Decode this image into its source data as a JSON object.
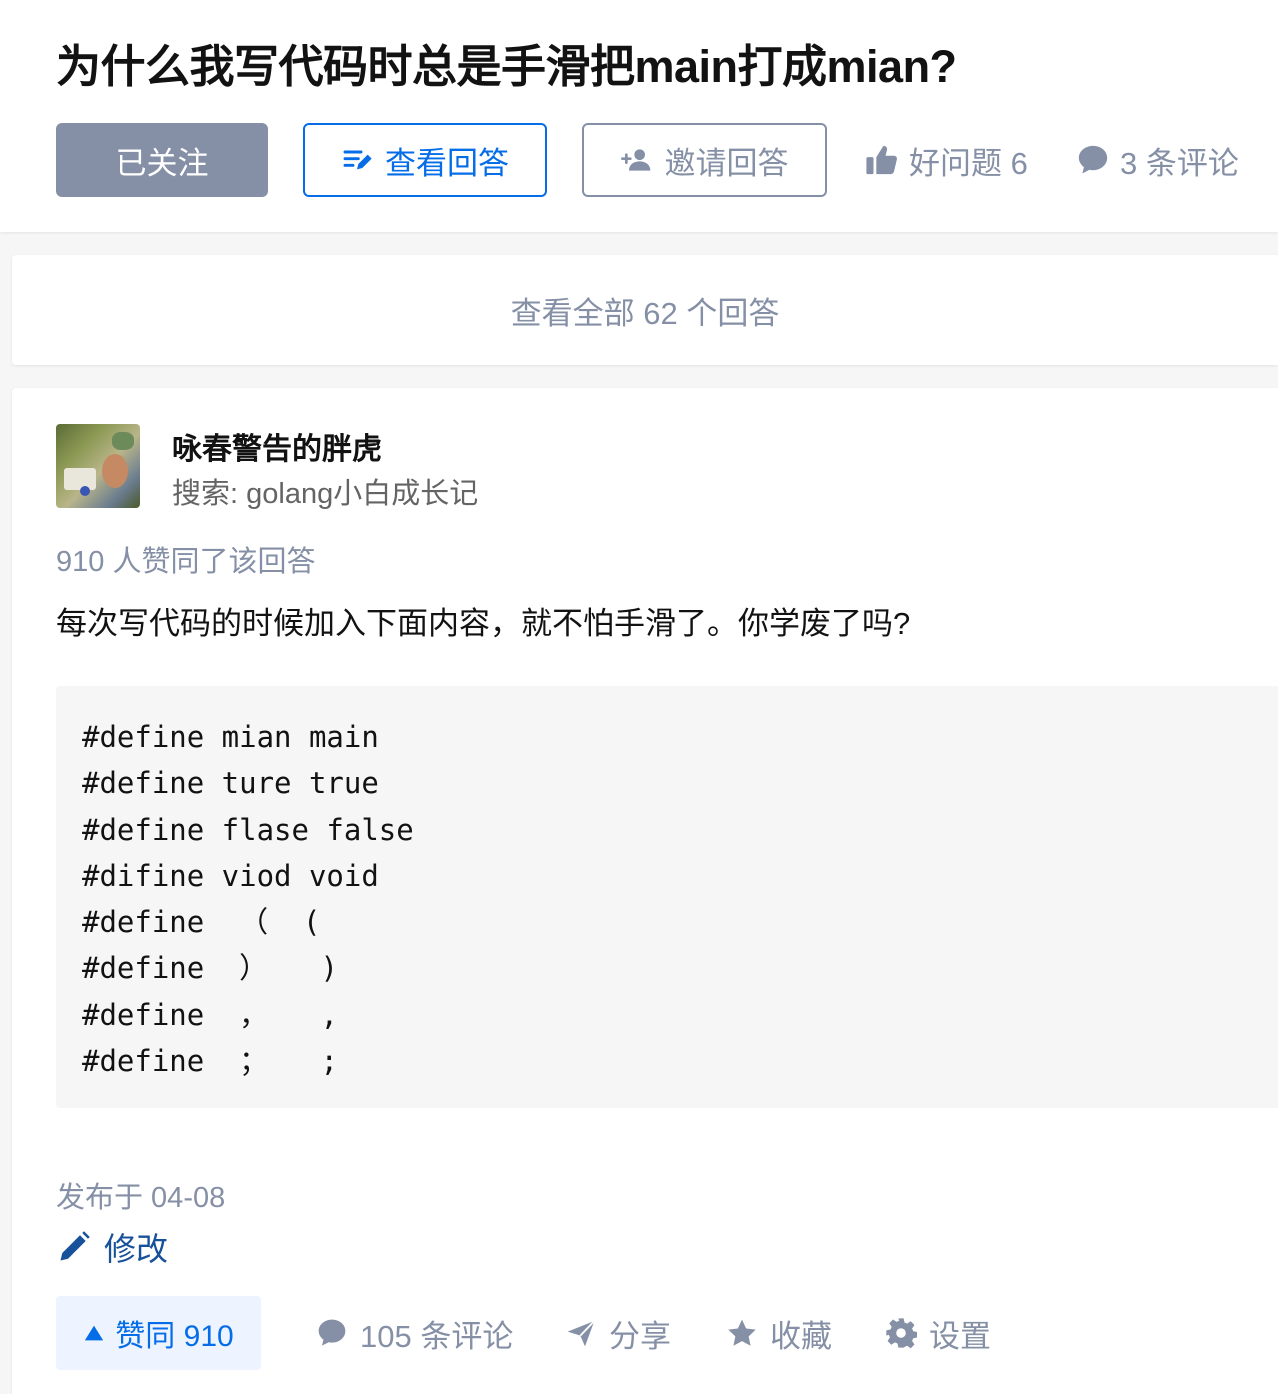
{
  "question": {
    "title": "为什么我写代码时总是手滑把main打成mian?",
    "follow_label": "已关注",
    "view_answers_label": "查看回答",
    "invite_label": "邀请回答",
    "good_question_label": "好问题 6",
    "comments_label": "3 条评论"
  },
  "view_all": {
    "label": "查看全部 62 个回答"
  },
  "answer": {
    "author": {
      "name": "咏春警告的胖虎",
      "bio": "搜索: golang小白成长记"
    },
    "vote_summary": "910 人赞同了该回答",
    "text": "每次写代码的时候加入下面内容，就不怕手滑了。你学废了吗?",
    "code_lines": [
      "#define mian main",
      "#define ture true",
      "#define flase false",
      "#difine viod void",
      "#define  （  (",
      "#define  ）   )",
      "#define  ，   ,",
      "#define  ；   ;"
    ],
    "published": "发布于 04-08",
    "edit_label": "修改",
    "actions": {
      "vote_up_label": "赞同 910",
      "comments_label": "105 条评论",
      "share_label": "分享",
      "collect_label": "收藏",
      "settings_label": "设置"
    }
  },
  "colors": {
    "brand_blue": "#056de8",
    "muted_gray": "#8590a6",
    "edit_blue": "#175199"
  },
  "icons": {
    "view_answers": "list-edit-icon",
    "invite": "add-user-icon",
    "good_question": "thumbs-up-icon",
    "comments": "comment-bubble-icon",
    "edit": "pencil-icon",
    "vote_up": "triangle-up-icon",
    "share": "paper-plane-icon",
    "collect": "star-icon",
    "settings": "gear-icon"
  }
}
